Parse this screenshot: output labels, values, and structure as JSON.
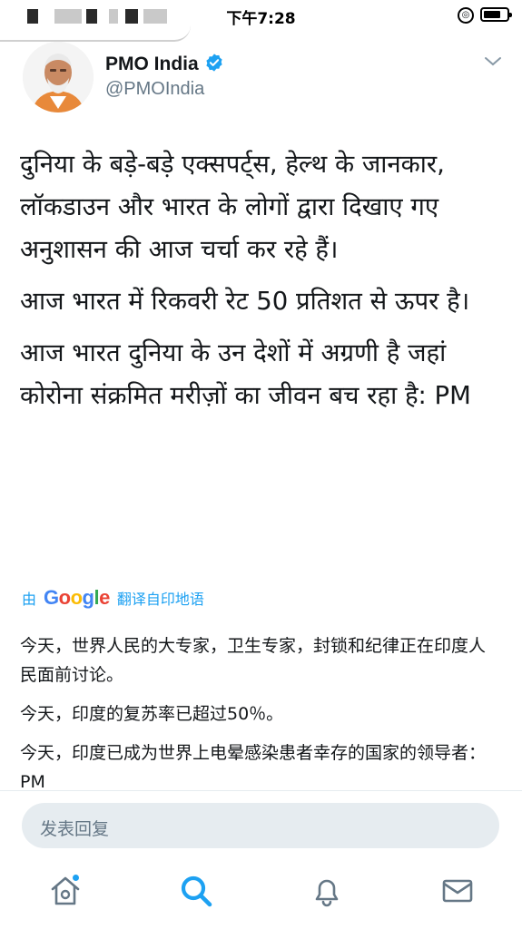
{
  "status_bar": {
    "time": "下午7:28"
  },
  "profile": {
    "name": "PMO India",
    "handle": "@PMOIndia"
  },
  "tweet": {
    "paragraphs": [
      "दुनिया के बड़े-बड़े एक्सपर्ट्स, हेल्थ के जानकार, लॉकडाउन और भारत के लोगों द्वारा दिखाए गए अनुशासन की आज चर्चा कर रहे हैं।",
      "आज भारत में रिकवरी रेट 50 प्रतिशत से ऊपर है।",
      "आज भारत दुनिया के उन देशों में अग्रणी है जहां कोरोना संक्रमित मरीज़ों का जीवन बच रहा है: PM"
    ]
  },
  "translation": {
    "by_label": "由",
    "brand": "Google",
    "action_label": "翻译自印地语",
    "paragraphs": [
      "今天，世界人民的大专家，卫生专家，封锁和纪律正在印度人民面前讨论。",
      "今天，印度的复苏率已超过50％。",
      "今天，印度已成为世界上电晕感染患者幸存的国家的领导者：PM"
    ]
  },
  "reply": {
    "placeholder": "发表回复"
  },
  "tabbar": {
    "items": [
      "home-icon",
      "search-icon",
      "notifications-icon",
      "messages-icon"
    ],
    "active": "search-icon",
    "accent": "#1da1f2",
    "inactive": "#657786"
  },
  "colors": {
    "accent": "#1da1f2",
    "secondary_text": "#657786",
    "text": "#14171a"
  }
}
